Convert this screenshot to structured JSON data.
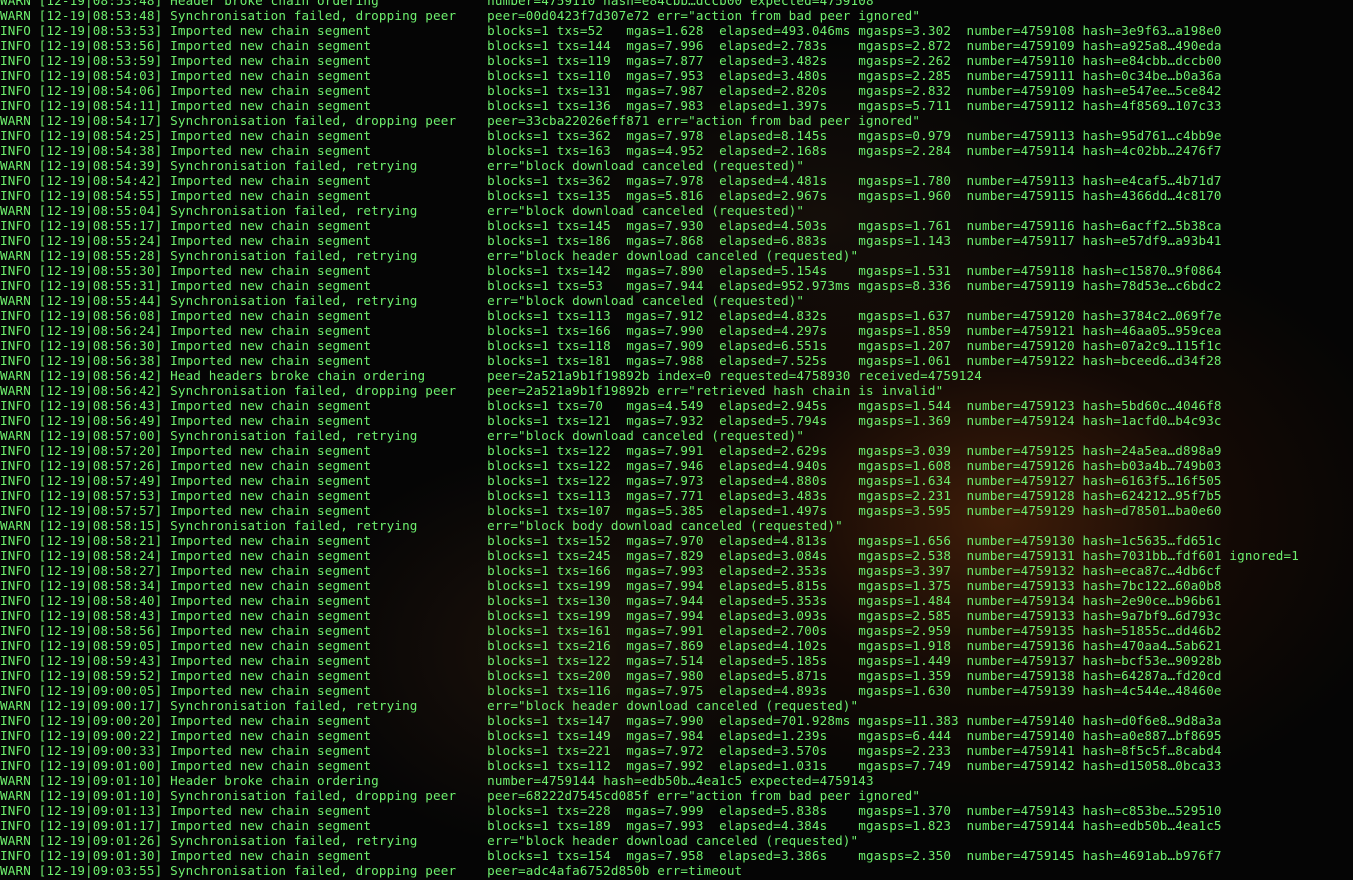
{
  "terminal": {
    "lines": [
      "WARN [12-19|08:53:48] Header broke chain ordering              number=4759110 hash=e84cbb…dccb00 expected=4759108",
      "WARN [12-19|08:53:48] Synchronisation failed, dropping peer    peer=00d0423f7d307e72 err=\"action from bad peer ignored\"",
      "INFO [12-19|08:53:53] Imported new chain segment               blocks=1 txs=52   mgas=1.628  elapsed=493.046ms mgasps=3.302  number=4759108 hash=3e9f63…a198e0",
      "INFO [12-19|08:53:56] Imported new chain segment               blocks=1 txs=144  mgas=7.996  elapsed=2.783s    mgasps=2.872  number=4759109 hash=a925a8…490eda",
      "INFO [12-19|08:53:59] Imported new chain segment               blocks=1 txs=119  mgas=7.877  elapsed=3.482s    mgasps=2.262  number=4759110 hash=e84cbb…dccb00",
      "INFO [12-19|08:54:03] Imported new chain segment               blocks=1 txs=110  mgas=7.953  elapsed=3.480s    mgasps=2.285  number=4759111 hash=0c34be…b0a36a",
      "INFO [12-19|08:54:06] Imported new chain segment               blocks=1 txs=131  mgas=7.987  elapsed=2.820s    mgasps=2.832  number=4759109 hash=e547ee…5ce842",
      "INFO [12-19|08:54:11] Imported new chain segment               blocks=1 txs=136  mgas=7.983  elapsed=1.397s    mgasps=5.711  number=4759112 hash=4f8569…107c33",
      "WARN [12-19|08:54:17] Synchronisation failed, dropping peer    peer=33cba22026eff871 err=\"action from bad peer ignored\"",
      "INFO [12-19|08:54:25] Imported new chain segment               blocks=1 txs=362  mgas=7.978  elapsed=8.145s    mgasps=0.979  number=4759113 hash=95d761…c4bb9e",
      "INFO [12-19|08:54:38] Imported new chain segment               blocks=1 txs=163  mgas=4.952  elapsed=2.168s    mgasps=2.284  number=4759114 hash=4c02bb…2476f7",
      "WARN [12-19|08:54:39] Synchronisation failed, retrying         err=\"block download canceled (requested)\"",
      "INFO [12-19|08:54:42] Imported new chain segment               blocks=1 txs=362  mgas=7.978  elapsed=4.481s    mgasps=1.780  number=4759113 hash=e4caf5…4b71d7",
      "INFO [12-19|08:54:55] Imported new chain segment               blocks=1 txs=135  mgas=5.816  elapsed=2.967s    mgasps=1.960  number=4759115 hash=4366dd…4c8170",
      "WARN [12-19|08:55:04] Synchronisation failed, retrying         err=\"block download canceled (requested)\"",
      "INFO [12-19|08:55:17] Imported new chain segment               blocks=1 txs=145  mgas=7.930  elapsed=4.503s    mgasps=1.761  number=4759116 hash=6acff2…5b38ca",
      "INFO [12-19|08:55:24] Imported new chain segment               blocks=1 txs=186  mgas=7.868  elapsed=6.883s    mgasps=1.143  number=4759117 hash=e57df9…a93b41",
      "WARN [12-19|08:55:28] Synchronisation failed, retrying         err=\"block header download canceled (requested)\"",
      "INFO [12-19|08:55:30] Imported new chain segment               blocks=1 txs=142  mgas=7.890  elapsed=5.154s    mgasps=1.531  number=4759118 hash=c15870…9f0864",
      "INFO [12-19|08:55:31] Imported new chain segment               blocks=1 txs=53   mgas=7.944  elapsed=952.973ms mgasps=8.336  number=4759119 hash=78d53e…c6bdc2",
      "WARN [12-19|08:55:44] Synchronisation failed, retrying         err=\"block download canceled (requested)\"",
      "INFO [12-19|08:56:08] Imported new chain segment               blocks=1 txs=113  mgas=7.912  elapsed=4.832s    mgasps=1.637  number=4759120 hash=3784c2…069f7e",
      "INFO [12-19|08:56:24] Imported new chain segment               blocks=1 txs=166  mgas=7.990  elapsed=4.297s    mgasps=1.859  number=4759121 hash=46aa05…959cea",
      "INFO [12-19|08:56:30] Imported new chain segment               blocks=1 txs=118  mgas=7.909  elapsed=6.551s    mgasps=1.207  number=4759120 hash=07a2c9…115f1c",
      "INFO [12-19|08:56:38] Imported new chain segment               blocks=1 txs=181  mgas=7.988  elapsed=7.525s    mgasps=1.061  number=4759122 hash=bceed6…d34f28",
      "WARN [12-19|08:56:42] Head headers broke chain ordering        peer=2a521a9b1f19892b index=0 requested=4758930 received=4759124",
      "WARN [12-19|08:56:42] Synchronisation failed, dropping peer    peer=2a521a9b1f19892b err=\"retrieved hash chain is invalid\"",
      "INFO [12-19|08:56:43] Imported new chain segment               blocks=1 txs=70   mgas=4.549  elapsed=2.945s    mgasps=1.544  number=4759123 hash=5bd60c…4046f8",
      "INFO [12-19|08:56:49] Imported new chain segment               blocks=1 txs=121  mgas=7.932  elapsed=5.794s    mgasps=1.369  number=4759124 hash=1acfd0…b4c93c",
      "WARN [12-19|08:57:00] Synchronisation failed, retrying         err=\"block download canceled (requested)\"",
      "INFO [12-19|08:57:20] Imported new chain segment               blocks=1 txs=122  mgas=7.991  elapsed=2.629s    mgasps=3.039  number=4759125 hash=24a5ea…d898a9",
      "INFO [12-19|08:57:26] Imported new chain segment               blocks=1 txs=122  mgas=7.946  elapsed=4.940s    mgasps=1.608  number=4759126 hash=b03a4b…749b03",
      "INFO [12-19|08:57:49] Imported new chain segment               blocks=1 txs=122  mgas=7.973  elapsed=4.880s    mgasps=1.634  number=4759127 hash=6163f5…16f505",
      "INFO [12-19|08:57:53] Imported new chain segment               blocks=1 txs=113  mgas=7.771  elapsed=3.483s    mgasps=2.231  number=4759128 hash=624212…95f7b5",
      "INFO [12-19|08:57:57] Imported new chain segment               blocks=1 txs=107  mgas=5.385  elapsed=1.497s    mgasps=3.595  number=4759129 hash=d78501…ba0e60",
      "WARN [12-19|08:58:15] Synchronisation failed, retrying         err=\"block body download canceled (requested)\"",
      "INFO [12-19|08:58:21] Imported new chain segment               blocks=1 txs=152  mgas=7.970  elapsed=4.813s    mgasps=1.656  number=4759130 hash=1c5635…fd651c",
      "INFO [12-19|08:58:24] Imported new chain segment               blocks=1 txs=245  mgas=7.829  elapsed=3.084s    mgasps=2.538  number=4759131 hash=7031bb…fdf601 ignored=1",
      "INFO [12-19|08:58:27] Imported new chain segment               blocks=1 txs=166  mgas=7.993  elapsed=2.353s    mgasps=3.397  number=4759132 hash=eca87c…4db6cf",
      "INFO [12-19|08:58:34] Imported new chain segment               blocks=1 txs=199  mgas=7.994  elapsed=5.815s    mgasps=1.375  number=4759133 hash=7bc122…60a0b8",
      "INFO [12-19|08:58:40] Imported new chain segment               blocks=1 txs=130  mgas=7.944  elapsed=5.353s    mgasps=1.484  number=4759134 hash=2e90ce…b96b61",
      "INFO [12-19|08:58:43] Imported new chain segment               blocks=1 txs=199  mgas=7.994  elapsed=3.093s    mgasps=2.585  number=4759133 hash=9a7bf9…6d793c",
      "INFO [12-19|08:58:56] Imported new chain segment               blocks=1 txs=161  mgas=7.991  elapsed=2.700s    mgasps=2.959  number=4759135 hash=51855c…dd46b2",
      "INFO [12-19|08:59:05] Imported new chain segment               blocks=1 txs=216  mgas=7.869  elapsed=4.102s    mgasps=1.918  number=4759136 hash=470aa4…5ab621",
      "INFO [12-19|08:59:43] Imported new chain segment               blocks=1 txs=122  mgas=7.514  elapsed=5.185s    mgasps=1.449  number=4759137 hash=bcf53e…90928b",
      "INFO [12-19|08:59:52] Imported new chain segment               blocks=1 txs=200  mgas=7.980  elapsed=5.871s    mgasps=1.359  number=4759138 hash=64287a…fd20cd",
      "INFO [12-19|09:00:05] Imported new chain segment               blocks=1 txs=116  mgas=7.975  elapsed=4.893s    mgasps=1.630  number=4759139 hash=4c544e…48460e",
      "WARN [12-19|09:00:17] Synchronisation failed, retrying         err=\"block header download canceled (requested)\"",
      "INFO [12-19|09:00:20] Imported new chain segment               blocks=1 txs=147  mgas=7.990  elapsed=701.928ms mgasps=11.383 number=4759140 hash=d0f6e8…9d8a3a",
      "INFO [12-19|09:00:22] Imported new chain segment               blocks=1 txs=149  mgas=7.984  elapsed=1.239s    mgasps=6.444  number=4759140 hash=a0e887…bf8695",
      "INFO [12-19|09:00:33] Imported new chain segment               blocks=1 txs=221  mgas=7.972  elapsed=3.570s    mgasps=2.233  number=4759141 hash=8f5c5f…8cabd4",
      "INFO [12-19|09:01:00] Imported new chain segment               blocks=1 txs=112  mgas=7.992  elapsed=1.031s    mgasps=7.749  number=4759142 hash=d15058…0bca33",
      "WARN [12-19|09:01:10] Header broke chain ordering              number=4759144 hash=edb50b…4ea1c5 expected=4759143",
      "WARN [12-19|09:01:10] Synchronisation failed, dropping peer    peer=68222d7545cd085f err=\"action from bad peer ignored\"",
      "INFO [12-19|09:01:13] Imported new chain segment               blocks=1 txs=228  mgas=7.999  elapsed=5.838s    mgasps=1.370  number=4759143 hash=c853be…529510",
      "INFO [12-19|09:01:17] Imported new chain segment               blocks=1 txs=189  mgas=7.993  elapsed=4.384s    mgasps=1.823  number=4759144 hash=edb50b…4ea1c5",
      "WARN [12-19|09:01:26] Synchronisation failed, retrying         err=\"block header download canceled (requested)\"",
      "INFO [12-19|09:01:30] Imported new chain segment               blocks=1 txs=154  mgas=7.958  elapsed=3.386s    mgasps=2.350  number=4759145 hash=4691ab…b976f7",
      "WARN [12-19|09:03:55] Synchronisation failed, dropping peer    peer=adc4afa6752d850b err=timeout"
    ]
  }
}
